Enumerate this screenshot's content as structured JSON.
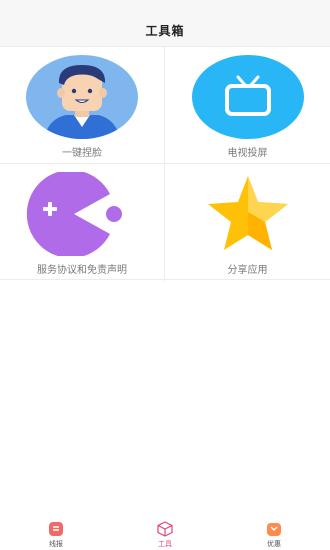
{
  "header": {
    "title": "工具箱"
  },
  "tools": [
    {
      "label": "一键捏脸",
      "icon": "face-avatar-icon"
    },
    {
      "label": "电视投屏",
      "icon": "tv-icon"
    },
    {
      "label": "服务协议和免责声明",
      "icon": "gamepad-pacman-icon"
    },
    {
      "label": "分享应用",
      "icon": "star-icon"
    }
  ],
  "tabbar": {
    "items": [
      {
        "label": "线报",
        "icon": "news-icon",
        "active": false
      },
      {
        "label": "工具",
        "icon": "cube-icon",
        "active": true
      },
      {
        "label": "优惠",
        "icon": "coupon-bag-icon",
        "active": false
      }
    ]
  },
  "colors": {
    "header_bg": "#f7f7f7",
    "active_tab": "#e0457b",
    "avatar_bg": "#7fb6ee",
    "tv_bg": "#29b6f6",
    "gamepad_purple": "#b06be8",
    "star_yellow": "#ffc107"
  }
}
